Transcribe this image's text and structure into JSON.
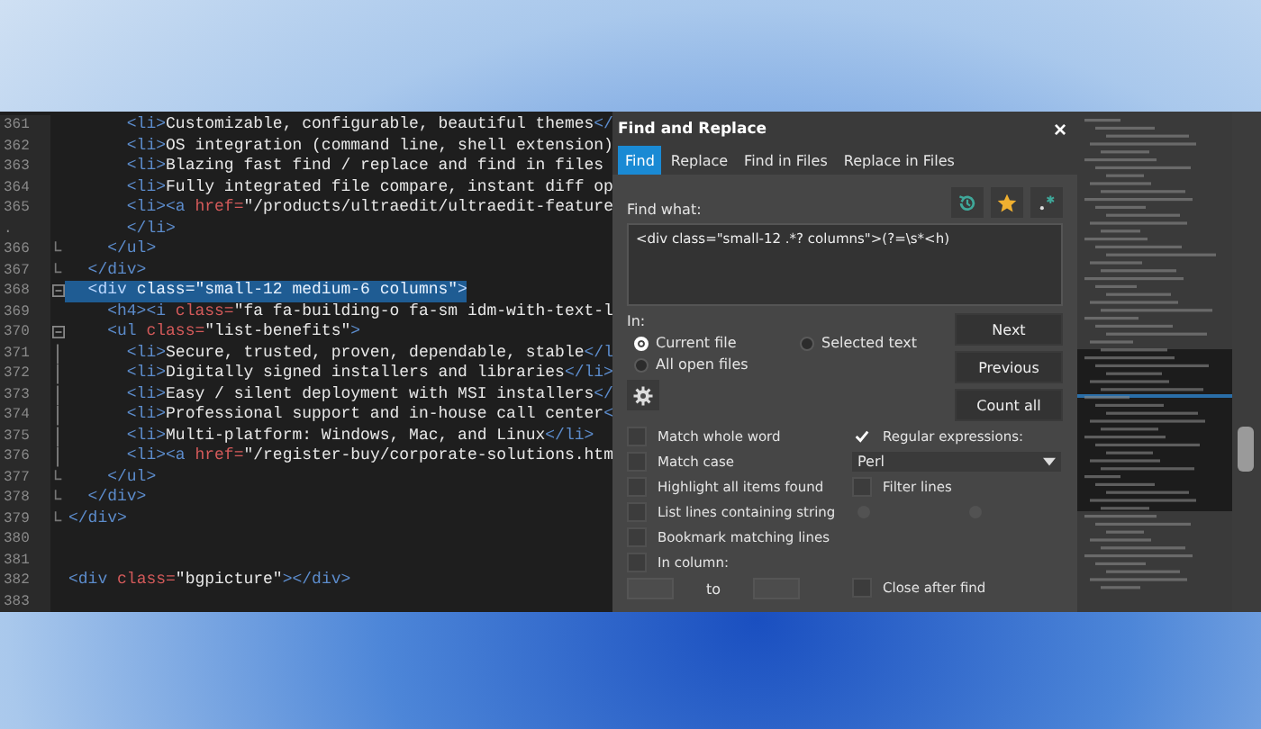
{
  "editor": {
    "lines": [
      {
        "number": "361",
        "tokens": [
          {
            "kind": "tag",
            "text": "      <li>"
          },
          {
            "kind": "text",
            "text": "Customizable, configurable, beautiful themes"
          },
          {
            "kind": "tag",
            "text": "</"
          }
        ]
      },
      {
        "number": "362",
        "tokens": [
          {
            "kind": "tag",
            "text": "      <li>"
          },
          {
            "kind": "text",
            "text": "OS integration (command line, shell extension)"
          }
        ]
      },
      {
        "number": "363",
        "tokens": [
          {
            "kind": "tag",
            "text": "      <li>"
          },
          {
            "kind": "text",
            "text": "Blazing fast find / replace and find in files"
          }
        ]
      },
      {
        "number": "364",
        "tokens": [
          {
            "kind": "tag",
            "text": "      <li>"
          },
          {
            "kind": "text",
            "text": "Fully integrated file compare, instant diff op"
          }
        ]
      },
      {
        "number": "365",
        "tokens": [
          {
            "kind": "tag",
            "text": "      <li><a "
          },
          {
            "kind": "attr",
            "text": "href="
          },
          {
            "kind": "string",
            "text": "\"/products/ultraedit/ultraedit-feature"
          }
        ]
      },
      {
        "number": ".",
        "tokens": [
          {
            "kind": "tag",
            "text": "      </li>"
          }
        ]
      },
      {
        "number": "366",
        "fold_end": true,
        "tokens": [
          {
            "kind": "tag",
            "text": "    </ul>"
          }
        ]
      },
      {
        "number": "367",
        "fold_end": true,
        "tokens": [
          {
            "kind": "tag",
            "text": "  </div>"
          }
        ]
      },
      {
        "number": "368",
        "foldable": true,
        "selected": true,
        "tokens": [
          {
            "kind": "tag",
            "text": "  <div "
          },
          {
            "kind": "attr",
            "text": "class="
          },
          {
            "kind": "string",
            "text": "\"small-12 medium-6 columns\""
          },
          {
            "kind": "tag",
            "text": ">"
          }
        ]
      },
      {
        "number": "369",
        "selected": false,
        "tokens": [
          {
            "kind": "tag",
            "text": "    <h4><i "
          },
          {
            "kind": "attr",
            "text": "class="
          },
          {
            "kind": "string",
            "text": "\"fa fa-building-o fa-sm idm-with-text-l"
          }
        ]
      },
      {
        "number": "370",
        "foldable": true,
        "tokens": [
          {
            "kind": "tag",
            "text": "    <ul "
          },
          {
            "kind": "attr",
            "text": "class="
          },
          {
            "kind": "string",
            "text": "\"list-benefits\""
          },
          {
            "kind": "tag",
            "text": ">"
          }
        ]
      },
      {
        "number": "371",
        "in_fold": true,
        "tokens": [
          {
            "kind": "tag",
            "text": "      <li>"
          },
          {
            "kind": "text",
            "text": "Secure, trusted, proven, dependable, stable"
          },
          {
            "kind": "tag",
            "text": "</l"
          }
        ]
      },
      {
        "number": "372",
        "in_fold": true,
        "tokens": [
          {
            "kind": "tag",
            "text": "      <li>"
          },
          {
            "kind": "text",
            "text": "Digitally signed installers and libraries"
          },
          {
            "kind": "tag",
            "text": "</li>"
          }
        ]
      },
      {
        "number": "373",
        "in_fold": true,
        "tokens": [
          {
            "kind": "tag",
            "text": "      <li>"
          },
          {
            "kind": "text",
            "text": "Easy / silent deployment with MSI installers"
          },
          {
            "kind": "tag",
            "text": "</"
          }
        ]
      },
      {
        "number": "374",
        "in_fold": true,
        "tokens": [
          {
            "kind": "tag",
            "text": "      <li>"
          },
          {
            "kind": "text",
            "text": "Professional support and in-house call center"
          },
          {
            "kind": "tag",
            "text": "<"
          }
        ]
      },
      {
        "number": "375",
        "in_fold": true,
        "tokens": [
          {
            "kind": "tag",
            "text": "      <li>"
          },
          {
            "kind": "text",
            "text": "Multi-platform: Windows, Mac, and Linux"
          },
          {
            "kind": "tag",
            "text": "</li>"
          }
        ]
      },
      {
        "number": "376",
        "in_fold": true,
        "tokens": [
          {
            "kind": "tag",
            "text": "      <li><a "
          },
          {
            "kind": "attr",
            "text": "href="
          },
          {
            "kind": "string",
            "text": "\"/register-buy/corporate-solutions.htm"
          }
        ]
      },
      {
        "number": "377",
        "fold_end": true,
        "tokens": [
          {
            "kind": "tag",
            "text": "    </ul>"
          }
        ]
      },
      {
        "number": "378",
        "fold_end": true,
        "tokens": [
          {
            "kind": "tag",
            "text": "  </div>"
          }
        ]
      },
      {
        "number": "379",
        "fold_end": true,
        "tokens": [
          {
            "kind": "tag",
            "text": "</div>"
          }
        ]
      },
      {
        "number": "380"
      },
      {
        "number": "381"
      },
      {
        "number": "382",
        "tokens": [
          {
            "kind": "tag",
            "text": "<div "
          },
          {
            "kind": "attr",
            "text": "class="
          },
          {
            "kind": "string",
            "text": "\"bgpicture\""
          },
          {
            "kind": "tag",
            "text": "></div>"
          }
        ]
      },
      {
        "number": "383"
      }
    ]
  },
  "dialog": {
    "title": "Find and Replace",
    "close": "×",
    "tabs": [
      {
        "label": "Find",
        "selected": true
      },
      {
        "label": "Replace",
        "selected": false
      },
      {
        "label": "Find in Files",
        "selected": false
      },
      {
        "label": "Replace in Files",
        "selected": false
      }
    ],
    "find_label": "Find what:",
    "find_value": "<div class=\"small-12 .*? columns\">(?=\\s*<h)",
    "in_label": "In:",
    "scopes": [
      {
        "label": "Current file",
        "selected": true
      },
      {
        "label": "Selected text",
        "selected": false
      },
      {
        "label": "All open files",
        "selected": false
      }
    ],
    "actions": [
      "Next",
      "Previous",
      "Count all"
    ],
    "options": [
      {
        "label": "Match whole word",
        "checked": false
      },
      {
        "label": "Match case",
        "checked": false
      },
      {
        "label": "Highlight all items found",
        "checked": false
      },
      {
        "label": "List lines containing string",
        "checked": false
      },
      {
        "label": "Bookmark matching lines",
        "checked": false
      },
      {
        "label": "In column:",
        "checked": false
      }
    ],
    "regex": {
      "label": "Regular expressions:",
      "checked": true,
      "engine": "Perl"
    },
    "filter": {
      "label": "Filter lines",
      "checked": false
    },
    "column_to": "to",
    "close_after": {
      "label": "Close after find",
      "checked": false
    }
  }
}
